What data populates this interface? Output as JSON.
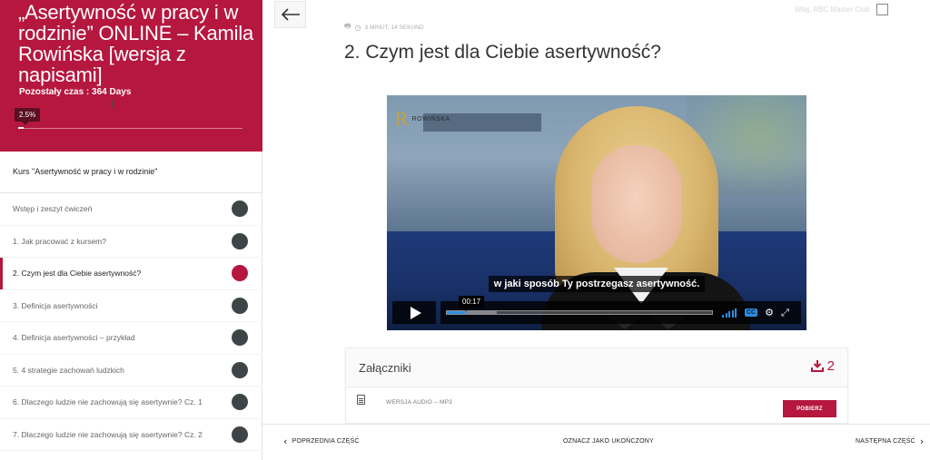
{
  "sidebar": {
    "course_title": "„Asertywność w pracy i w rodzinie” ONLINE – Kamila Rowińska [wersja z napisami]",
    "time_left": "Pozostały czas : 364 Days",
    "progress_label": "2.5%",
    "progress_value": 2.5,
    "course_label": "Kurs \"Asertywność w pracy i w rodzinie\"",
    "lessons": [
      {
        "label": "Wstęp i zeszyt ćwiczeń"
      },
      {
        "label": "1. Jak pracować z kursem?"
      },
      {
        "label": "2. Czym jest dla Ciebie asertywność?"
      },
      {
        "label": "3. Definicja asertywności"
      },
      {
        "label": "4. Definicja asertywności – przykład"
      },
      {
        "label": "5. 4 strategie zachowań ludzkich"
      },
      {
        "label": "6. Dlaczego ludzie nie zachowują się asertywnie? Cz. 1"
      },
      {
        "label": "7. Dlaczego ludzie nie zachowują się asertywnie? Cz. 2"
      }
    ]
  },
  "header": {
    "meta_duration": "3 MINUT, 14 SEKUND",
    "watermark": "Wtaj, RBC Master Club"
  },
  "lesson": {
    "title": "2. Czym jest dla Ciebie asertywność?"
  },
  "video": {
    "logo_text": "ROWIŃSKA",
    "subtitle": "w jaki sposób Ty postrzegasz asertywność.",
    "timecode": "00:17",
    "played_fraction": 0.07,
    "buffered_fraction": 0.19,
    "cc_label": "CC"
  },
  "attachments": {
    "title": "Załączniki",
    "count": "2",
    "items": [
      {
        "name": "WERSJA AUDIO – MP3",
        "button": "POBIERZ"
      }
    ]
  },
  "footer": {
    "prev": "POPRZEDNIA CZĘŚĆ",
    "mark_done": "OZNACZ JAKO UKOŃCZONY",
    "next": "NASTĘPNA CZĘŚĆ"
  },
  "colors": {
    "accent": "#b5173f",
    "dot": "#3f4547",
    "player_blue": "#2d8ee3"
  }
}
